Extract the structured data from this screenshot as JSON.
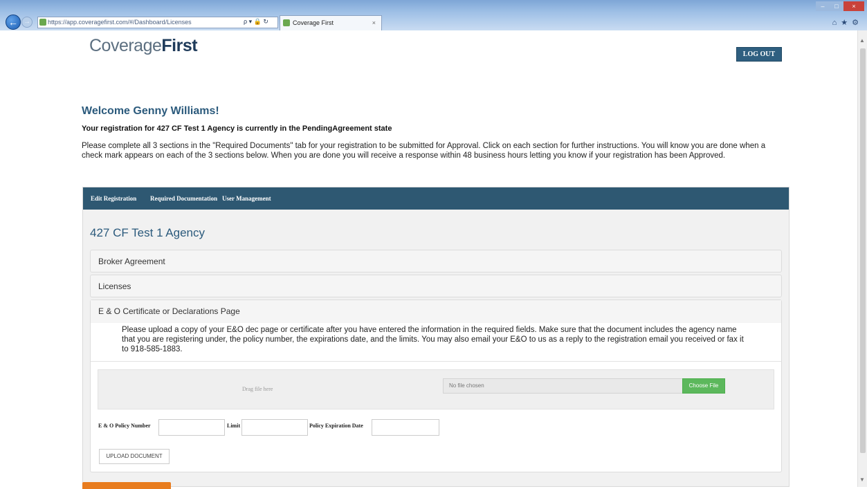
{
  "browser": {
    "url": "https://app.coveragefirst.com/#/Dashboard/Licenses",
    "tab_title": "Coverage First",
    "tab_close": "×",
    "addr_tools": "ρ ▾ 🔒 ↻",
    "right_tools": "⌂★⚙",
    "back_glyph": "←",
    "forward_glyph": "→",
    "min_glyph": "–",
    "max_glyph": "□",
    "close_glyph": "×",
    "scroll_up_glyph": "▲",
    "scroll_down_glyph": "▼"
  },
  "header": {
    "logo_light": "Coverage",
    "logo_bold": "First",
    "logout_label": "LOG OUT"
  },
  "intro": {
    "welcome": "Welcome Genny Williams!",
    "state": "Your registration for 427 CF Test 1 Agency is currently in the PendingAgreement state",
    "instructions": "Please complete all 3 sections in the \"Required Documents\" tab for your registration to be submitted for Approval. Click on each section for further instructions. You will know you are done when a check mark appears on each of the 3 sections below. When you are done you will receive a response within 48 business hours letting you know if your registration has been Approved."
  },
  "nav": {
    "items": [
      "Edit Registration",
      "Required Documentation",
      "User Management"
    ]
  },
  "agency": {
    "title": "427 CF Test 1 Agency"
  },
  "sections": {
    "broker": "Broker Agreement",
    "licenses": "Licenses",
    "eo": {
      "title": "E & O Certificate or Declarations Page",
      "instructions": "Please upload a copy of your E&O dec page or certificate after you have entered the information in the required fields. Make sure that the document includes the agency name that you are registering under, the policy number, the expirations date, and the limits. You may also email your E&O to us as a reply to the registration email you received or fax it to 918-585-1883.",
      "drag_text": "Drag file here",
      "file_status": "No file chosen",
      "choose_label": "Choose File",
      "policy_number_label": "E & O Policy Number",
      "limit_label": "Limit",
      "expiration_label": "Policy Expiration Date",
      "upload_label": "UPLOAD DOCUMENT",
      "policy_number_value": "",
      "limit_value": "",
      "expiration_value": ""
    }
  },
  "colors": {
    "navbar": "#2e5872",
    "accent_blue": "#2b5a7c",
    "choose_green": "#5cb85c",
    "orange": "#e87c1e"
  }
}
